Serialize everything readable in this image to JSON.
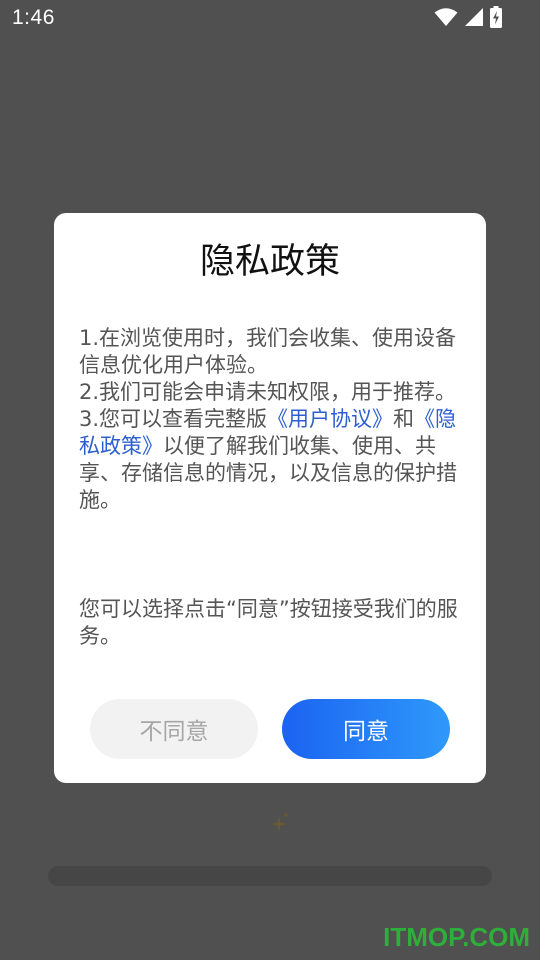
{
  "status_bar": {
    "time": "1:46",
    "icons": [
      "wifi-icon",
      "cellular-signal-icon",
      "battery-charging-icon"
    ]
  },
  "dialog": {
    "title": "隐私政策",
    "line1": "1.在浏览使用时，我们会收集、使用设备信息优化用户体验。",
    "line2": "2.我们可能会申请未知权限，用于推荐。",
    "line3_prefix": "3.您可以查看完整版",
    "user_agreement_link": "《用户协议》",
    "line3_and": "和",
    "privacy_policy_link": "《隐私政策》",
    "line3_suffix": "以便了解我们收集、使用、共享、存储信息的情况，以及信息的保护措施。",
    "consent_text": "您可以选择点击“同意”按钮接受我们的服务。",
    "decline_label": "不同意",
    "agree_label": "同意"
  },
  "watermark": "ITMOP.COM",
  "colors": {
    "overlay": "#505050",
    "link": "#2e5fd0",
    "agree_start": "#1b63f1",
    "agree_end": "#2f99fb",
    "decline_bg": "#f2f2f2",
    "watermark": "#2fae3a"
  }
}
